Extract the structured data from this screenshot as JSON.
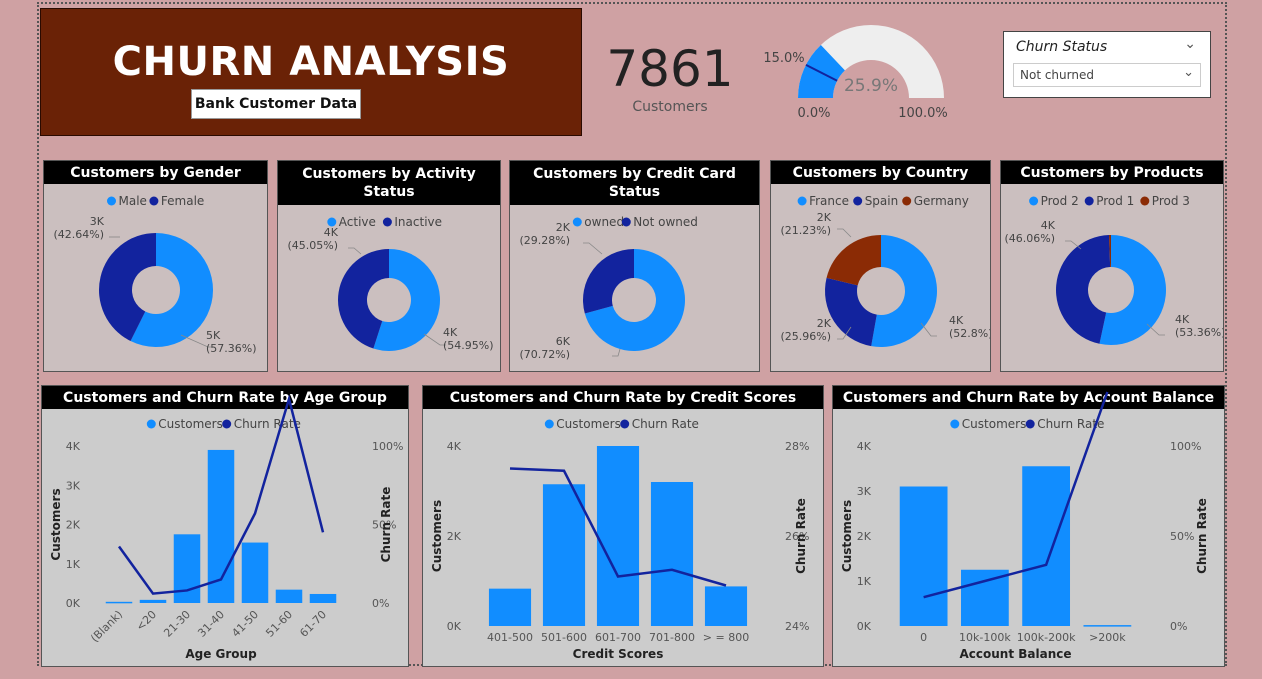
{
  "header": {
    "title": "CHURN ANALYSIS",
    "subtitle": "Bank Customer Data"
  },
  "kpi": {
    "value": "7861",
    "label": "Customers"
  },
  "gauge": {
    "value_label": "25.9%",
    "value": 25.9,
    "target_label": "15.0%",
    "target": 15.0,
    "min_label": "0.0%",
    "max_label": "100.0%"
  },
  "slicer": {
    "title": "Churn Status",
    "selected": "Not churned"
  },
  "colors": {
    "primary": "#118dff",
    "secondary": "#12239e",
    "tertiary": "#8b2b05",
    "title_bg": "#6a2206"
  },
  "chart_data": [
    {
      "type": "pie",
      "title": "Customers by Gender",
      "legend": [
        "Male",
        "Female"
      ],
      "slices": [
        {
          "name": "Male",
          "value": 57.36,
          "label": "5K",
          "pct_label": "(57.36%)"
        },
        {
          "name": "Female",
          "value": 42.64,
          "label": "3K",
          "pct_label": "(42.64%)"
        }
      ]
    },
    {
      "type": "pie",
      "title": "Customers by Activity Status",
      "legend": [
        "Active",
        "Inactive"
      ],
      "slices": [
        {
          "name": "Active",
          "value": 54.95,
          "label": "4K",
          "pct_label": "(54.95%)"
        },
        {
          "name": "Inactive",
          "value": 45.05,
          "label": "4K",
          "pct_label": "(45.05%)"
        }
      ]
    },
    {
      "type": "pie",
      "title": "Customers by Credit Card Status",
      "legend": [
        "owned",
        "Not owned"
      ],
      "slices": [
        {
          "name": "owned",
          "value": 70.72,
          "label": "6K",
          "pct_label": "(70.72%)"
        },
        {
          "name": "Not owned",
          "value": 29.28,
          "label": "2K",
          "pct_label": "(29.28%)"
        }
      ]
    },
    {
      "type": "pie",
      "title": "Customers by Country",
      "legend": [
        "France",
        "Spain",
        "Germany"
      ],
      "slices": [
        {
          "name": "France",
          "value": 52.8,
          "label": "4K",
          "pct_label": "(52.8%)"
        },
        {
          "name": "Spain",
          "value": 25.96,
          "label": "2K",
          "pct_label": "(25.96%)"
        },
        {
          "name": "Germany",
          "value": 21.23,
          "label": "2K",
          "pct_label": "(21.23%)"
        }
      ]
    },
    {
      "type": "pie",
      "title": "Customers by Products",
      "legend": [
        "Prod 2",
        "Prod 1",
        "Prod 3"
      ],
      "slices": [
        {
          "name": "Prod 2",
          "value": 53.36,
          "label": "4K",
          "pct_label": "(53.36%)"
        },
        {
          "name": "Prod 1",
          "value": 46.06,
          "label": "4K",
          "pct_label": "(46.06%)"
        },
        {
          "name": "Prod 3",
          "value": 0.58,
          "label": "",
          "pct_label": ""
        }
      ]
    },
    {
      "type": "bar",
      "title": "Customers and Churn Rate by Age Group",
      "xlabel": "Age Group",
      "ylabel": "Customers",
      "y2label": "Churn Rate",
      "legend": [
        "Customers",
        "Churn Rate"
      ],
      "categories": [
        "(Blank)",
        "<20",
        "21-30",
        "31-40",
        "41-50",
        "51-60",
        "61-70"
      ],
      "series": [
        {
          "name": "Customers",
          "values": [
            30,
            80,
            1750,
            3900,
            1540,
            340,
            230
          ]
        },
        {
          "name": "Churn Rate",
          "values": [
            36,
            6,
            8,
            15,
            57,
            130,
            45
          ]
        }
      ],
      "ylim": [
        0,
        4000
      ],
      "y_ticks": [
        "0K",
        "1K",
        "2K",
        "3K",
        "4K"
      ],
      "y2lim": [
        0,
        100
      ],
      "y2_ticks": [
        "0%",
        "50%",
        "100%"
      ]
    },
    {
      "type": "bar",
      "title": "Customers and Churn Rate by Credit Scores",
      "xlabel": "Credit Scores",
      "ylabel": "Customers",
      "y2label": "Churn Rate",
      "legend": [
        "Customers",
        "Churn Rate"
      ],
      "categories": [
        "401-500",
        "501-600",
        "601-700",
        "701-800",
        "> = 800"
      ],
      "series": [
        {
          "name": "Customers",
          "values": [
            830,
            3150,
            5000,
            3200,
            880
          ]
        },
        {
          "name": "Churn Rate",
          "values": [
            27.5,
            27.45,
            25.1,
            25.25,
            24.9
          ]
        }
      ],
      "ylim": [
        0,
        4000
      ],
      "y_ticks": [
        "0K",
        "2K",
        "4K"
      ],
      "y2lim": [
        24,
        28
      ],
      "y2_ticks": [
        "24%",
        "26%",
        "28%"
      ]
    },
    {
      "type": "bar",
      "title": "Customers and Churn Rate by Account Balance",
      "xlabel": "Account Balance",
      "ylabel": "Customers",
      "y2label": "Churn Rate",
      "legend": [
        "Customers",
        "Churn Rate"
      ],
      "categories": [
        "0",
        "10k-100k",
        "100k-200k",
        ">200k"
      ],
      "series": [
        {
          "name": "Customers",
          "values": [
            3100,
            1250,
            3550,
            20
          ]
        },
        {
          "name": "Churn Rate",
          "values": [
            16,
            25,
            34,
            130
          ]
        }
      ],
      "ylim": [
        0,
        4000
      ],
      "y_ticks": [
        "0K",
        "1K",
        "2K",
        "3K",
        "4K"
      ],
      "y2lim": [
        0,
        100
      ],
      "y2_ticks": [
        "0%",
        "50%",
        "100%"
      ]
    }
  ]
}
